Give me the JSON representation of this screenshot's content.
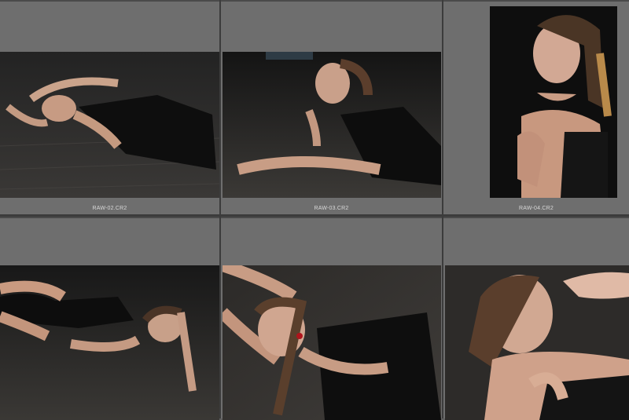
{
  "app": {
    "view": "grid",
    "columns": 3
  },
  "grid": {
    "cells": [
      {
        "filename": "RAW-02.CR2",
        "orientation": "landscape"
      },
      {
        "filename": "RAW-03.CR2",
        "orientation": "landscape"
      },
      {
        "filename": "RAW-04.CR2",
        "orientation": "portrait"
      },
      {
        "filename": "",
        "orientation": "landscape"
      },
      {
        "filename": "",
        "orientation": "landscape"
      },
      {
        "filename": "",
        "orientation": "landscape"
      }
    ]
  },
  "colors": {
    "cell_background": "#6e6e6e",
    "gutter": "#3c3c3c",
    "label_text": "#d8d8d8"
  }
}
